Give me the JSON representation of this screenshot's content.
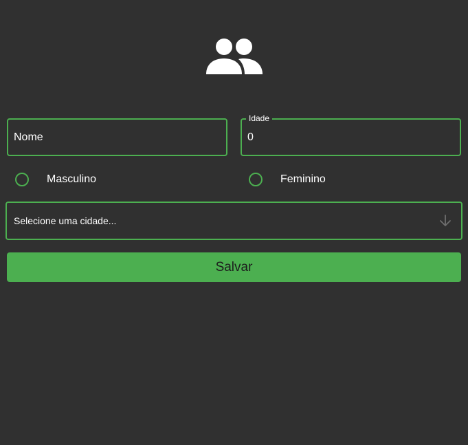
{
  "header": {
    "icon": "people-icon",
    "icon_color": "#ffffff"
  },
  "form": {
    "nome_placeholder": "Nome",
    "idade_label": "Idade",
    "idade_value": "0",
    "gender_options": [
      {
        "label": "Masculino",
        "selected": false
      },
      {
        "label": "Feminino",
        "selected": false
      }
    ],
    "city_select_placeholder": "Selecione uma cidade...",
    "city_select_icon": "arrow-down-icon",
    "save_label": "Salvar"
  },
  "colors": {
    "background": "#303030",
    "accent": "#4caf50",
    "text": "#ffffff",
    "button_text": "#1d1d1d"
  }
}
